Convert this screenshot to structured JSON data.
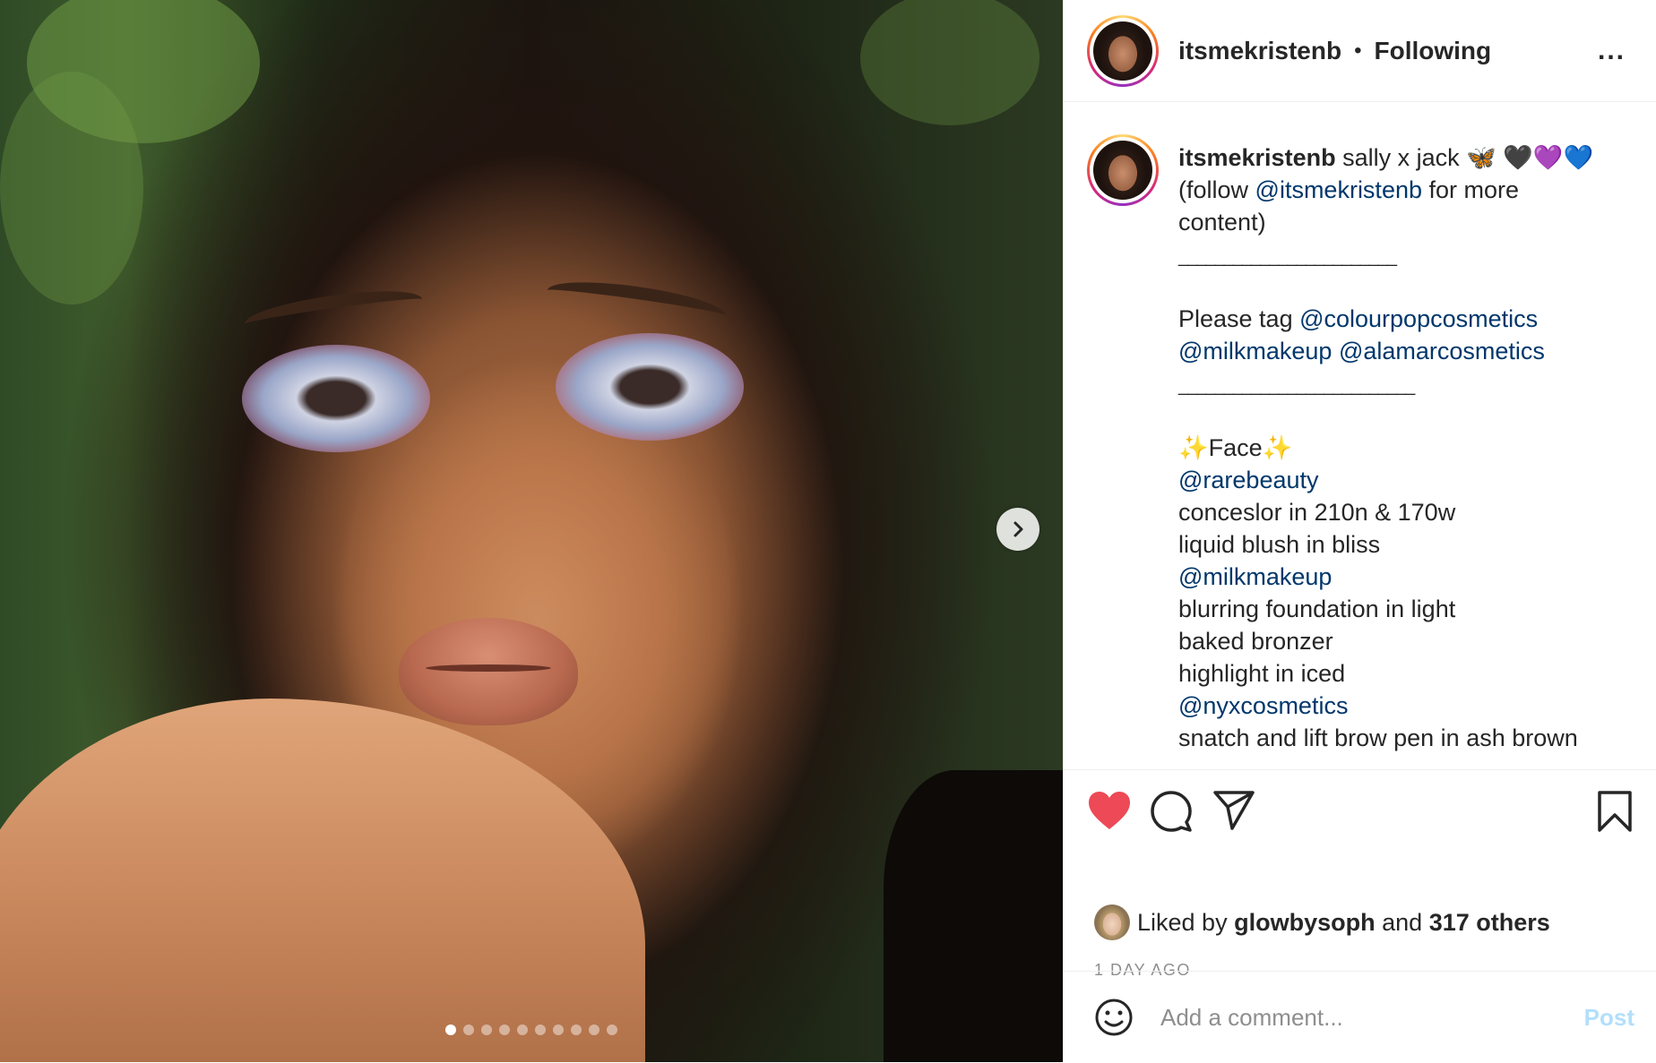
{
  "header": {
    "username": "itsmekristenb",
    "separator": "•",
    "follow_status": "Following",
    "more_label": "..."
  },
  "caption": {
    "username": "itsmekristenb",
    "title": "sally x jack 🦋 🖤💜💙",
    "follow_prefix": "(follow ",
    "follow_mention": "@itsmekristenb",
    "follow_suffix": " for more",
    "follow_line2": "content)",
    "rule1": "________________________",
    "tag_prefix": "Please tag ",
    "tag_mention1": "@colourpopcosmetics",
    "tag_mention2": "@milkmakeup",
    "tag_mention3": "@alamarcosmetics",
    "rule2": "__________________________",
    "face_heading": "✨Face✨",
    "brand1": "@rarebeauty",
    "item1": "conceslor in 210n & 170w",
    "item2": "liquid blush in bliss",
    "brand2": "@milkmakeup",
    "item3": "blurring foundation in light",
    "item4": "baked bronzer",
    "item5": "highlight in iced",
    "brand3": "@nyxcosmetics",
    "item6": "snatch and lift brow pen in ash brown"
  },
  "likes": {
    "prefix": "Liked by ",
    "user": "glowbysoph",
    "middle": " and ",
    "others": "317 others"
  },
  "timestamp": "1 DAY AGO",
  "comment": {
    "placeholder": "Add a comment...",
    "post_label": "Post"
  },
  "carousel": {
    "total_slides": 10,
    "active_index": 0
  },
  "colors": {
    "heart": "#ed4956",
    "link": "#00376b",
    "post_disabled": "#b2dffc"
  },
  "icons": [
    "heart-icon",
    "comment-icon",
    "share-icon",
    "bookmark-icon",
    "emoji-icon",
    "chevron-right-icon",
    "more-icon"
  ]
}
